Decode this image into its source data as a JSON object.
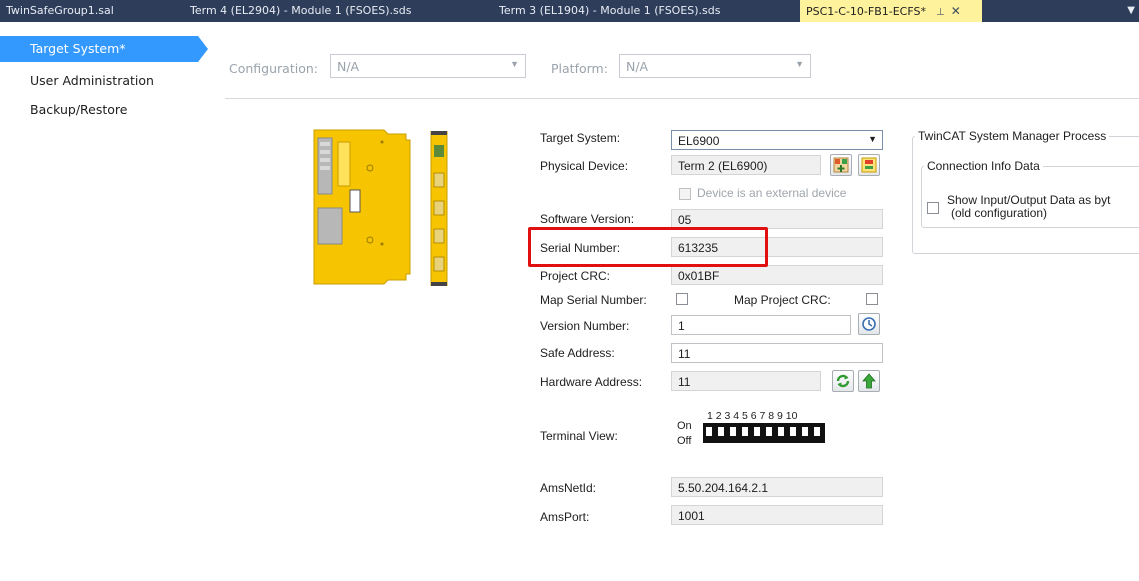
{
  "tabs": [
    {
      "label": "TwinSafeGroup1.sal"
    },
    {
      "label": "Term 4 (EL2904) - Module 1 (FSOES).sds"
    },
    {
      "label": "Term 3 (EL1904) - Module 1 (FSOES).sds"
    },
    {
      "label": "PSC1-C-10-FB1-ECFS*"
    }
  ],
  "nav": {
    "items": [
      {
        "label": "Target System*"
      },
      {
        "label": "User Administration"
      },
      {
        "label": "Backup/Restore"
      }
    ]
  },
  "config": {
    "configuration_label": "Configuration:",
    "configuration_value": "N/A",
    "platform_label": "Platform:",
    "platform_value": "N/A"
  },
  "form": {
    "target_system_label": "Target System:",
    "target_system_value": "EL6900",
    "physical_device_label": "Physical Device:",
    "physical_device_value": "Term 2 (EL6900)",
    "external_device_label": "Device is an external device",
    "software_version_label": "Software Version:",
    "software_version_value": "05",
    "serial_number_label": "Serial Number:",
    "serial_number_value": "613235",
    "project_crc_label": "Project CRC:",
    "project_crc_value": "0x01BF",
    "map_serial_label": "Map Serial Number:",
    "map_project_crc_label": "Map Project CRC:",
    "version_number_label": "Version Number:",
    "version_number_value": "1",
    "safe_address_label": "Safe Address:",
    "safe_address_value": "11",
    "hardware_address_label": "Hardware Address:",
    "hardware_address_value": "11",
    "terminal_view_label": "Terminal View:",
    "dip_on": "On",
    "dip_off": "Off",
    "dip_numbers": "1 2 3 4 5 6 7 8 9 10",
    "amsnetid_label": "AmsNetId:",
    "amsnetid_value": "5.50.204.164.2.1",
    "amsport_label": "AmsPort:",
    "amsport_value": "1001"
  },
  "side_group": {
    "title": "TwinCAT System Manager Process",
    "inner_title": "Connection Info Data",
    "checkbox_line1": "Show Input/Output Data as byt",
    "checkbox_line2": "(old configuration)"
  },
  "colors": {
    "tabbar": "#2d3d5a",
    "active_tab": "#fff29d",
    "nav_active": "#3399ff",
    "highlight": "#e01010",
    "device_yellow": "#f6c400"
  }
}
